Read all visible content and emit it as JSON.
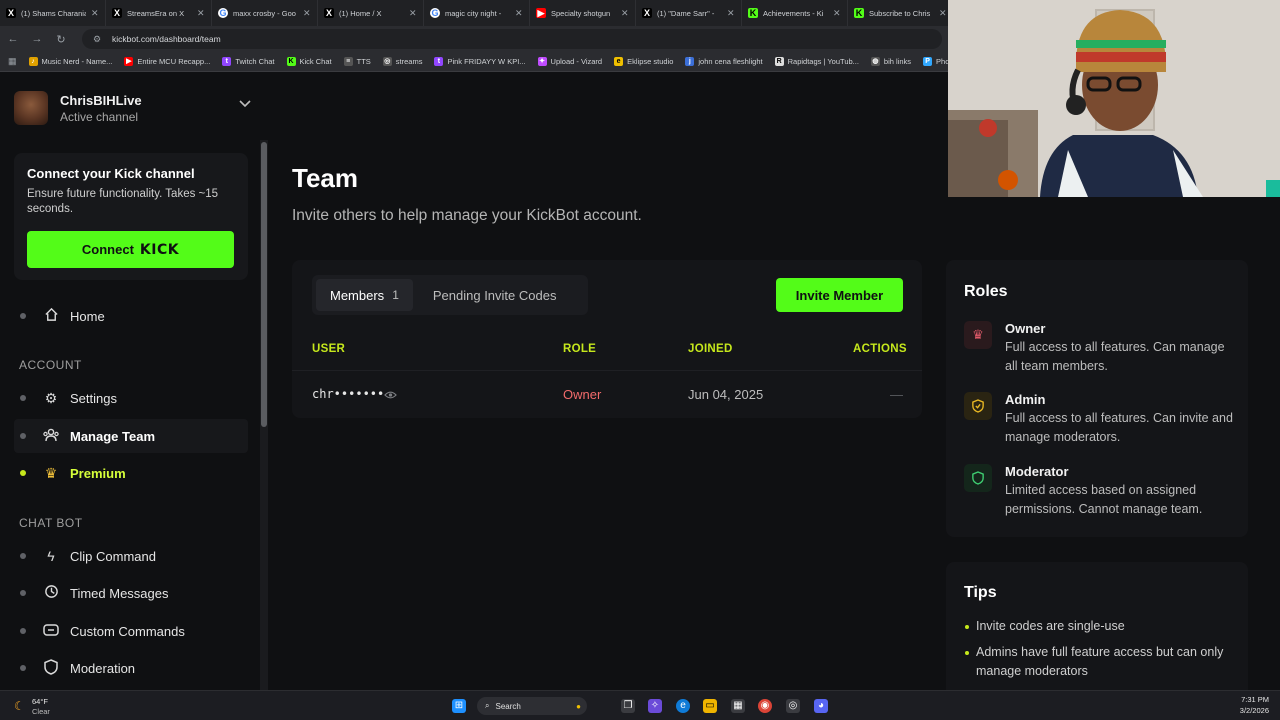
{
  "browser": {
    "tabs": [
      {
        "label": "(1) Shams Charania",
        "icon": "x-logo-icon",
        "color": "#000000"
      },
      {
        "label": "StreamsEra on X",
        "icon": "x-logo-icon",
        "color": "#000000"
      },
      {
        "label": "maxx crosby - Goo",
        "icon": "google-icon",
        "color": "#4285f4"
      },
      {
        "label": "(1) Home / X",
        "icon": "x-logo-icon",
        "color": "#000000"
      },
      {
        "label": "magic city night - ",
        "icon": "google-icon",
        "color": "#4285f4"
      },
      {
        "label": "Specialty shotgun",
        "icon": "youtube-icon",
        "color": "#ff0000"
      },
      {
        "label": "(1) \"Dame Sarr\" - ",
        "icon": "x-logo-icon",
        "color": "#000000"
      },
      {
        "label": "Achievements - Ki",
        "icon": "kick-icon",
        "color": "#53fc18"
      },
      {
        "label": "Subscribe to Chris",
        "icon": "kick-icon",
        "color": "#53fc18"
      }
    ],
    "url": "kickbot.com/dashboard/team",
    "bookmarks": [
      {
        "label": "Music Nerd - Name...",
        "color": "#e0a100"
      },
      {
        "label": "Entire MCU Recapp...",
        "color": "#ff0000"
      },
      {
        "label": "Twitch Chat",
        "color": "#9146ff"
      },
      {
        "label": "Kick Chat",
        "color": "#53fc18"
      },
      {
        "label": "TTS",
        "color": "#888888"
      },
      {
        "label": "streams",
        "color": "#888888"
      },
      {
        "label": "Pink FRIDAYY W KPI...",
        "color": "#9146ff"
      },
      {
        "label": "Upload - Vizard",
        "color": "#c04cff"
      },
      {
        "label": "Eklipse studio",
        "color": "#f0c000"
      },
      {
        "label": "john cena fleshlight",
        "color": "#3b6fd8"
      },
      {
        "label": "Rapidtags | YouTub...",
        "color": "#dddddd"
      },
      {
        "label": "bih links",
        "color": "#888888"
      },
      {
        "label": "Photop",
        "color": "#31a8ff"
      }
    ]
  },
  "sidebar": {
    "profile": {
      "name": "ChrisBIHLive",
      "status": "Active channel"
    },
    "connect": {
      "title": "Connect your Kick channel",
      "desc": "Ensure future functionality. Takes ~15 seconds.",
      "btn": "Connect",
      "logo": "KICK"
    },
    "home": "Home",
    "sections": {
      "account": "ACCOUNT",
      "chatbot": "CHAT BOT"
    },
    "account_items": [
      {
        "label": "Settings",
        "icon": "gear-icon"
      },
      {
        "label": "Manage Team",
        "icon": "team-icon"
      },
      {
        "label": "Premium",
        "icon": "crown-icon"
      }
    ],
    "chatbot_items": [
      {
        "label": "Clip Command",
        "icon": "lightning-icon"
      },
      {
        "label": "Timed Messages",
        "icon": "timer-icon"
      },
      {
        "label": "Custom Commands",
        "icon": "tag-icon"
      },
      {
        "label": "Moderation",
        "icon": "shield-icon"
      }
    ]
  },
  "main": {
    "title": "Team",
    "subtitle": "Invite others to help manage your KickBot account.",
    "tabs": [
      {
        "label": "Members",
        "count": "1"
      },
      {
        "label": "Pending Invite Codes",
        "count": ""
      }
    ],
    "invite_btn": "Invite Member",
    "columns": {
      "user": "USER",
      "role": "ROLE",
      "joined": "JOINED",
      "actions": "ACTIONS"
    },
    "rows": [
      {
        "user": "chr•••••••",
        "role": "Owner",
        "joined": "Jun 04, 2025",
        "actions": "—"
      }
    ]
  },
  "roles": {
    "title": "Roles",
    "items": [
      {
        "name": "Owner",
        "desc": "Full access to all features. Can manage all team members.",
        "icon": "crown-icon",
        "color": "#e05a6a"
      },
      {
        "name": "Admin",
        "desc": "Full access to all features. Can invite and manage moderators.",
        "icon": "shield-check-icon",
        "color": "#e9b824"
      },
      {
        "name": "Moderator",
        "desc": "Limited access based on assigned permissions. Cannot manage team.",
        "icon": "shield-icon",
        "color": "#3fcf72"
      }
    ]
  },
  "tips": {
    "title": "Tips",
    "items": [
      "Invite codes are single-use",
      "Admins have full feature access but can only manage moderators"
    ]
  },
  "taskbar": {
    "weather_temp": "64°F",
    "weather_desc": "Clear",
    "search": "Search",
    "time": "7:31 PM",
    "date": "3/2/2026"
  },
  "colors": {
    "accent": "#53fc18",
    "header_accent": "#c6e81c",
    "owner_red": "#f26b6b"
  }
}
